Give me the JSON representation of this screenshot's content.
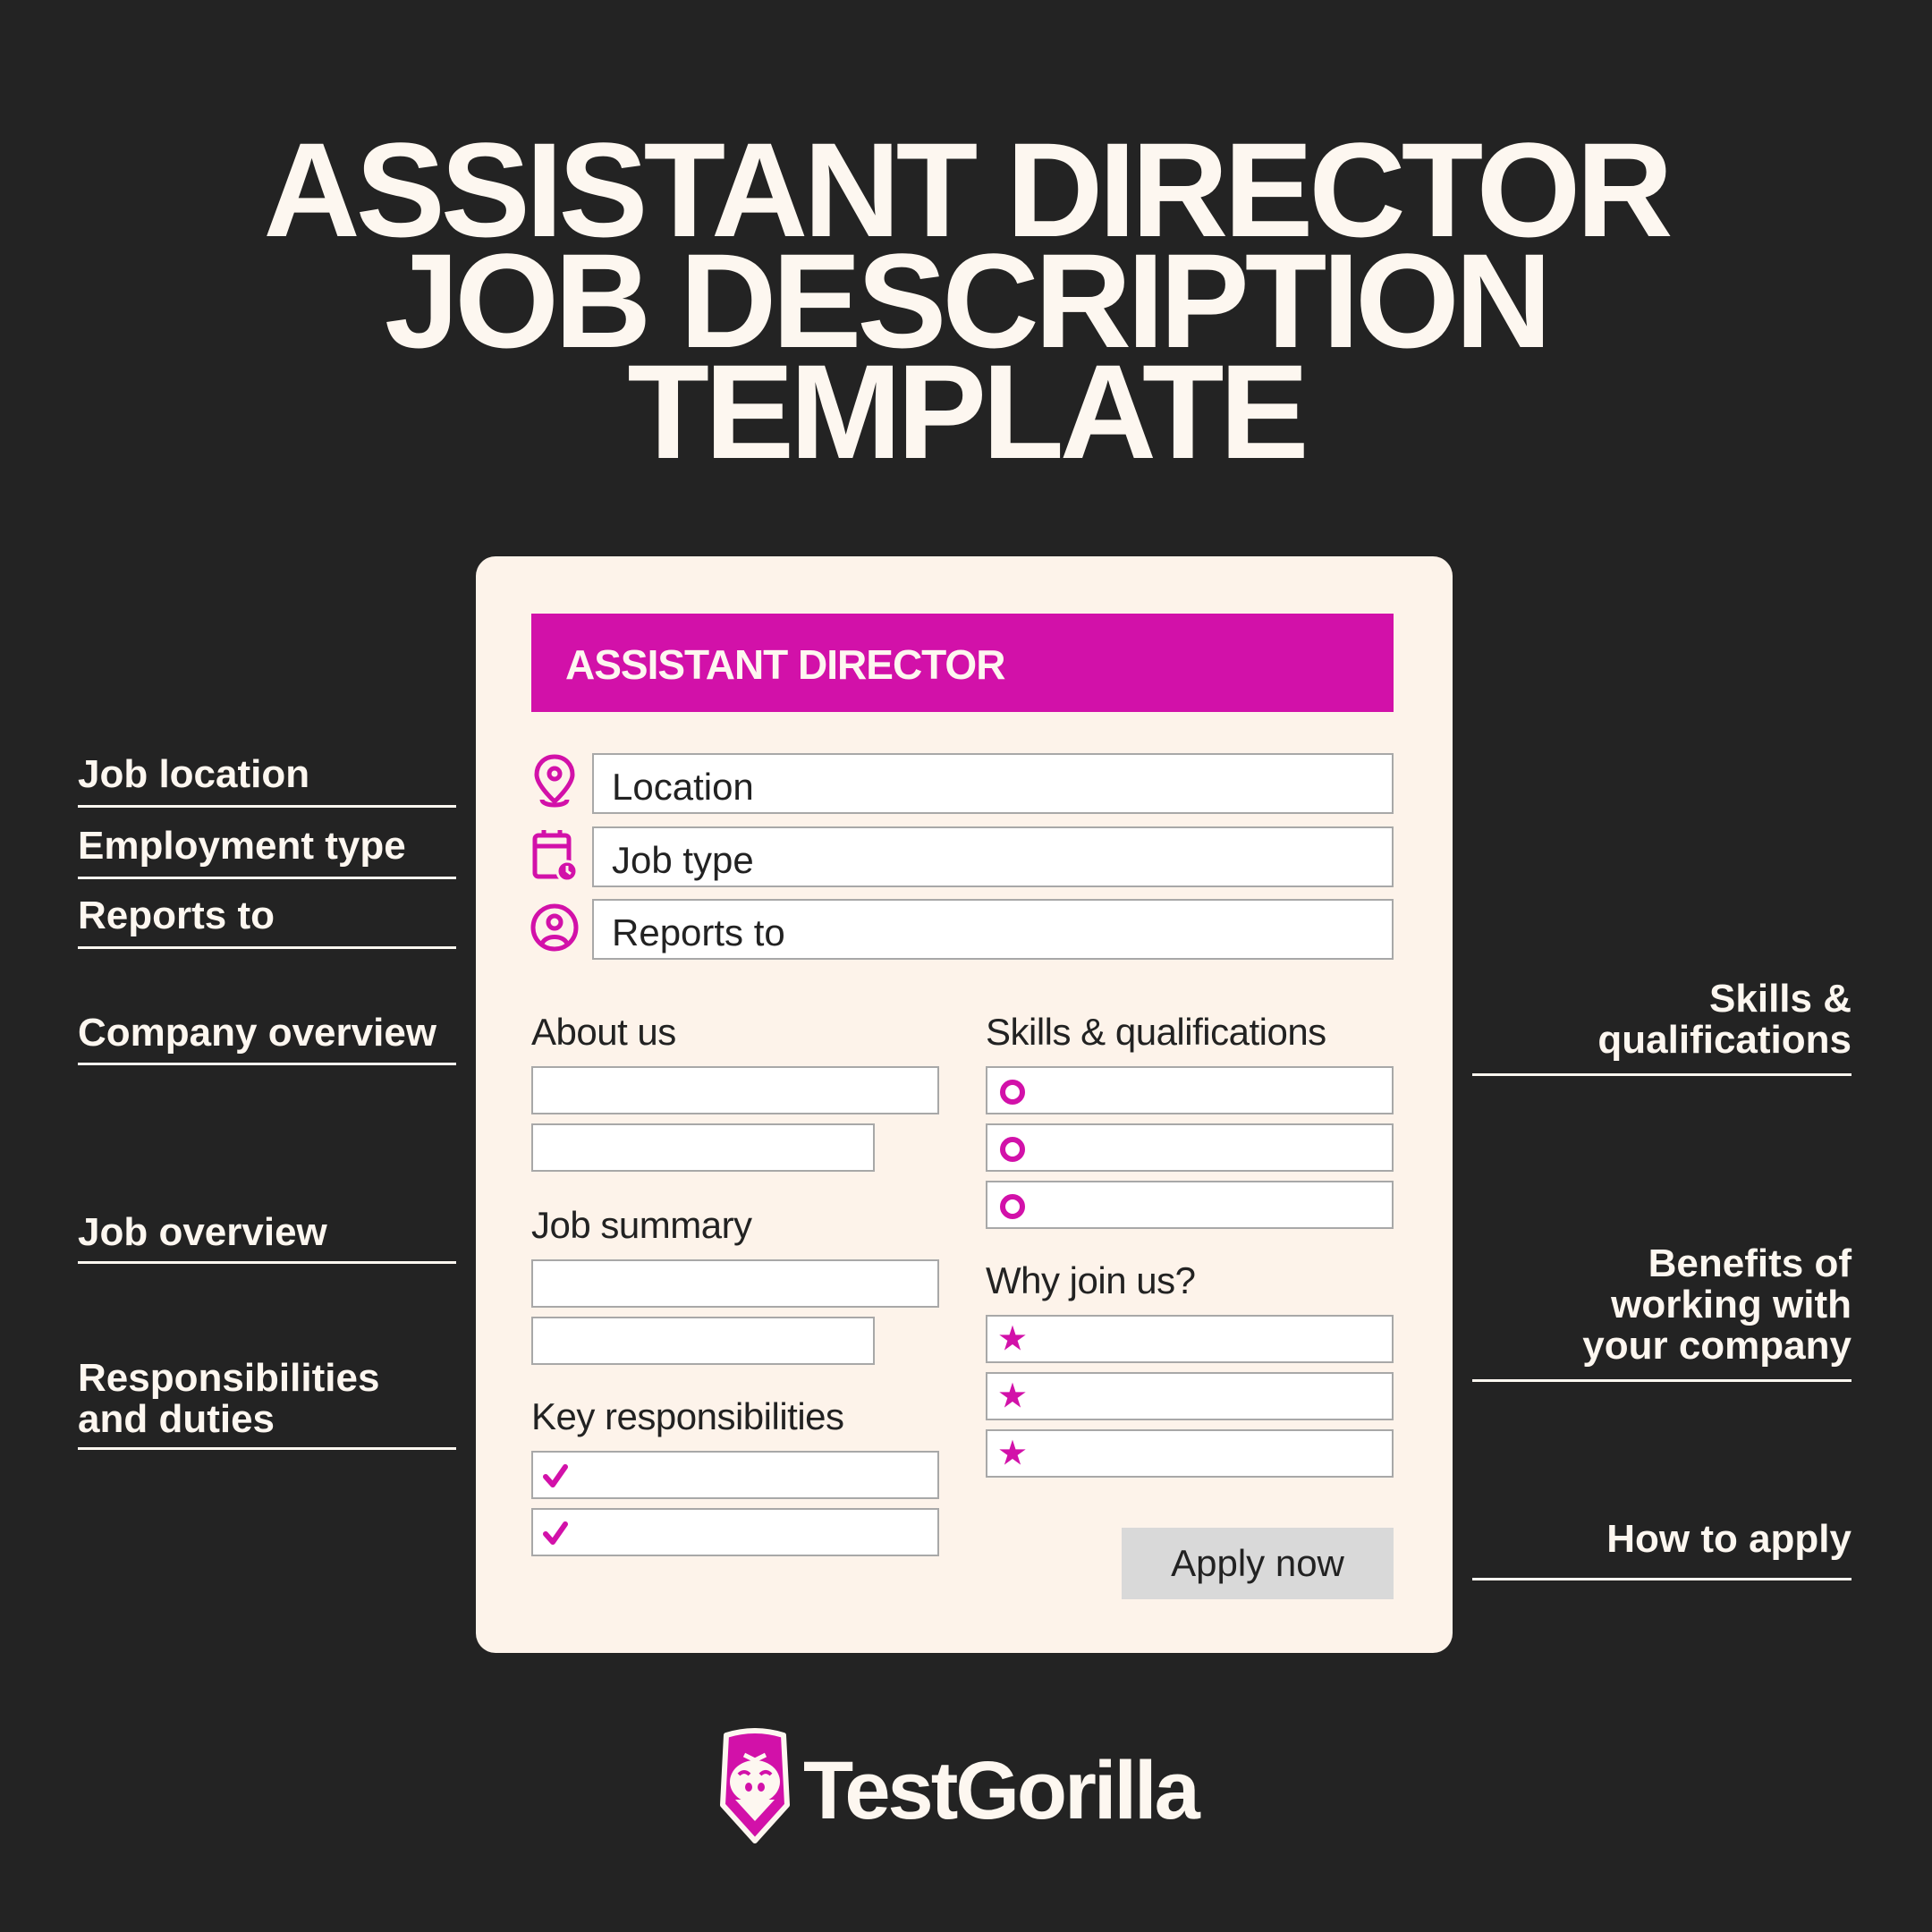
{
  "title": {
    "line1": "ASSISTANT DIRECTOR",
    "line2": "JOB DESCRIPTION",
    "line3": "TEMPLATE"
  },
  "colors": {
    "background": "#232323",
    "accent": "#d211a9",
    "card": "#fdf3ea",
    "text_light": "#fdf7f0"
  },
  "card": {
    "header": "ASSISTANT DIRECTOR",
    "fields": [
      {
        "icon": "location-pin-icon",
        "label": "Location"
      },
      {
        "icon": "calendar-clock-icon",
        "label": "Job type"
      },
      {
        "icon": "user-circle-icon",
        "label": "Reports to"
      }
    ],
    "sections": {
      "about": "About us",
      "job_summary": "Job summary",
      "key_responsibilities": "Key responsibilities",
      "skills": "Skills & qualifications",
      "why_join": "Why join us?"
    },
    "apply_button": "Apply now"
  },
  "left_labels": [
    "Job location",
    "Employment type",
    "Reports to",
    "Company overview",
    "Job overview",
    "Responsibilities and duties"
  ],
  "right_labels": [
    "Skills & qualifications",
    "Benefits of working with your company",
    "How to apply"
  ],
  "brand": {
    "name": "TestGorilla",
    "logo_icon": "gorilla-logo-icon"
  }
}
